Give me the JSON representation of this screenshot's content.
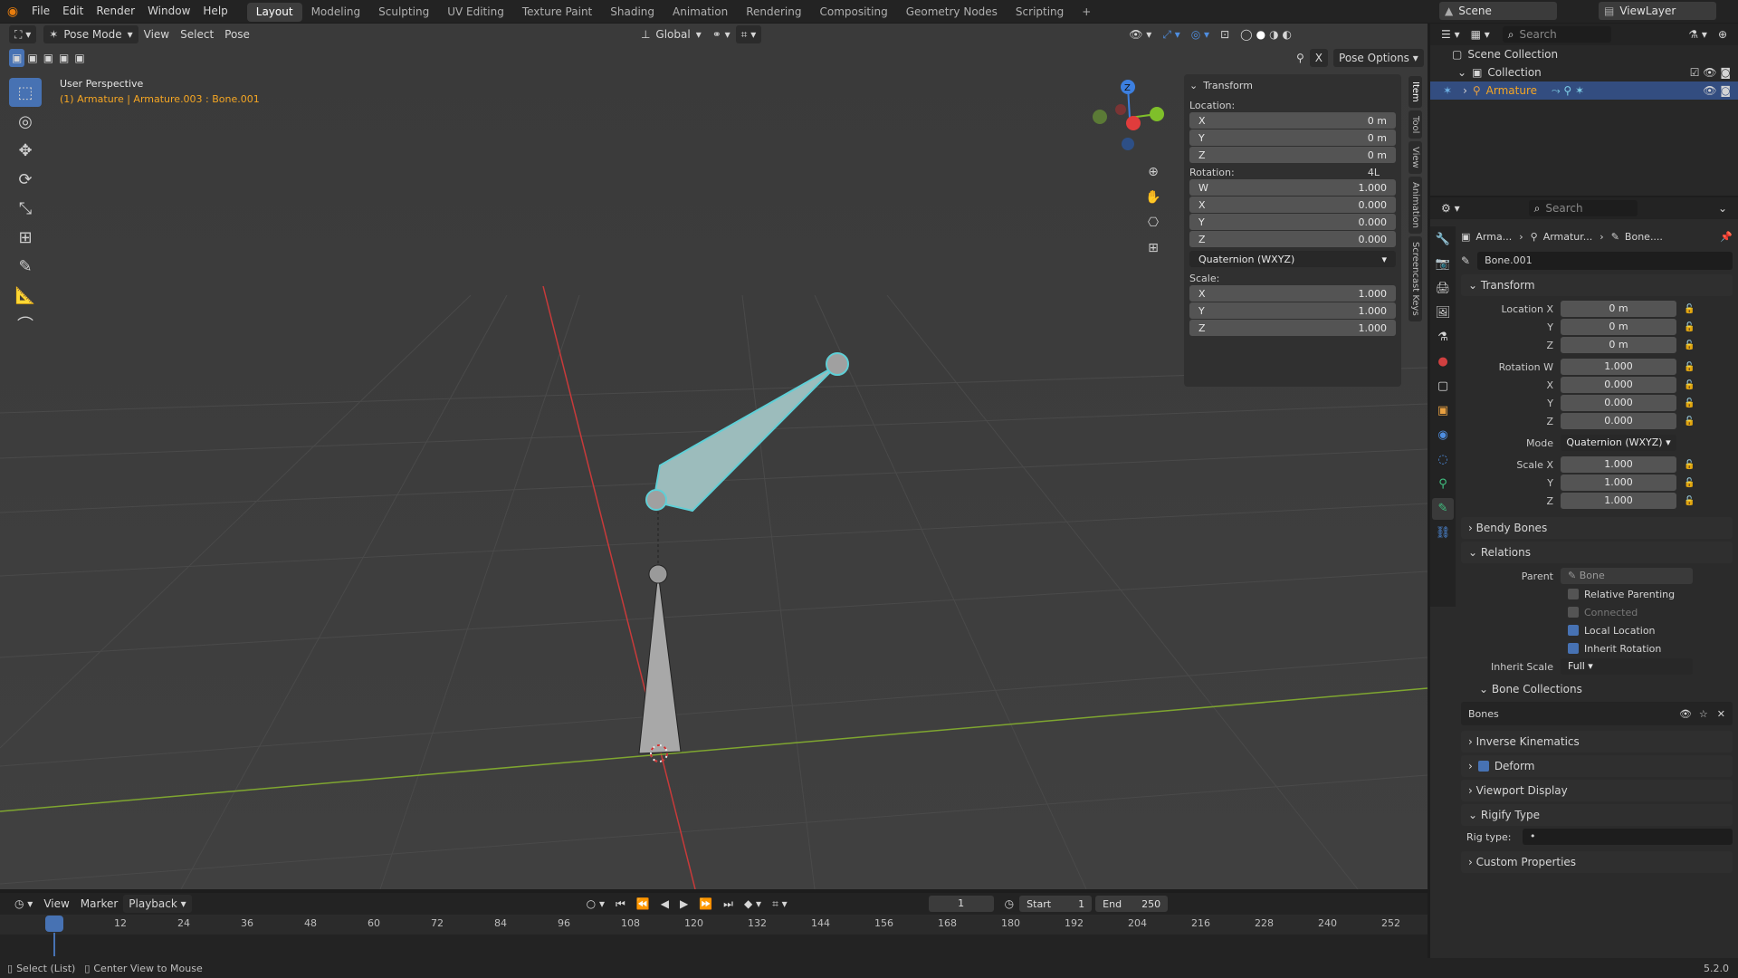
{
  "menus": [
    "File",
    "Edit",
    "Render",
    "Window",
    "Help"
  ],
  "workspaces": [
    "Layout",
    "Modeling",
    "Sculpting",
    "UV Editing",
    "Texture Paint",
    "Shading",
    "Animation",
    "Rendering",
    "Compositing",
    "Geometry Nodes",
    "Scripting",
    "+"
  ],
  "scene": {
    "label": "Scene",
    "viewlayer": "ViewLayer"
  },
  "viewport": {
    "mode": "Pose Mode",
    "menus": [
      "View",
      "Select",
      "Pose"
    ],
    "orientation": "Global",
    "pose_options": "Pose Options",
    "perspective": "User Perspective",
    "context": "(1) Armature | Armature.003 : Bone.001",
    "gizmo": {
      "z": "Z",
      "y": "Y",
      "x": "X"
    }
  },
  "npanel": {
    "header": "Transform",
    "location_label": "Location:",
    "location": [
      {
        "axis": "X",
        "value": "0 m"
      },
      {
        "axis": "Y",
        "value": "0 m"
      },
      {
        "axis": "Z",
        "value": "0 m"
      }
    ],
    "rotation_label": "Rotation:",
    "rotation_flag": "4L",
    "rotation": [
      {
        "axis": "W",
        "value": "1.000"
      },
      {
        "axis": "X",
        "value": "0.000"
      },
      {
        "axis": "Y",
        "value": "0.000"
      },
      {
        "axis": "Z",
        "value": "0.000"
      }
    ],
    "rotation_mode": "Quaternion (WXYZ)",
    "scale_label": "Scale:",
    "scale": [
      {
        "axis": "X",
        "value": "1.000"
      },
      {
        "axis": "Y",
        "value": "1.000"
      },
      {
        "axis": "Z",
        "value": "1.000"
      }
    ],
    "tabs": [
      "Item",
      "Tool",
      "View",
      "Animation",
      "Screencast Keys"
    ]
  },
  "outliner": {
    "search": "Search",
    "root": "Scene Collection",
    "collection": "Collection",
    "object": "Armature"
  },
  "properties": {
    "search": "Search",
    "breadcrumb": [
      "Arma...",
      "Armatur...",
      "Bone...."
    ],
    "bone_name": "Bone.001",
    "transform_header": "Transform",
    "location": [
      {
        "label": "Location X",
        "value": "0 m"
      },
      {
        "label": "Y",
        "value": "0 m"
      },
      {
        "label": "Z",
        "value": "0 m"
      }
    ],
    "rotation": [
      {
        "label": "Rotation W",
        "value": "1.000"
      },
      {
        "label": "X",
        "value": "0.000"
      },
      {
        "label": "Y",
        "value": "0.000"
      },
      {
        "label": "Z",
        "value": "0.000"
      }
    ],
    "mode_label": "Mode",
    "mode_value": "Quaternion (WXYZ)",
    "scale": [
      {
        "label": "Scale X",
        "value": "1.000"
      },
      {
        "label": "Y",
        "value": "1.000"
      },
      {
        "label": "Z",
        "value": "1.000"
      }
    ],
    "bendy_bones": "Bendy Bones",
    "relations": "Relations",
    "parent_label": "Parent",
    "parent_value": "Bone",
    "relative_parenting": "Relative Parenting",
    "connected": "Connected",
    "local_location": "Local Location",
    "inherit_rotation": "Inherit Rotation",
    "inherit_scale_label": "Inherit Scale",
    "inherit_scale_value": "Full",
    "bone_collections": "Bone Collections",
    "bones_item": "Bones",
    "inverse_kinematics": "Inverse Kinematics",
    "deform": "Deform",
    "viewport_display": "Viewport Display",
    "rigify_type": "Rigify Type",
    "rig_type_label": "Rig type:",
    "rig_type_value": "•",
    "custom_properties": "Custom Properties"
  },
  "timeline": {
    "menus": [
      "View",
      "Marker",
      "Playback"
    ],
    "current_frame": "1",
    "start_label": "Start",
    "start": "1",
    "end_label": "End",
    "end": "250",
    "ticks": [
      "1",
      "12",
      "24",
      "36",
      "48",
      "60",
      "72",
      "84",
      "96",
      "108",
      "120",
      "132",
      "144",
      "156",
      "168",
      "180",
      "192",
      "204",
      "216",
      "228",
      "240",
      "252"
    ]
  },
  "status": {
    "left": "Select (List)",
    "center": "Center View to Mouse",
    "version": "5.2.0"
  },
  "colors": {
    "accent": "#4772b3",
    "selected_bone": "#5fcfd6",
    "x_axis": "#e03c3c",
    "y_axis": "#7fbf2a",
    "z_axis": "#3c7fe0",
    "header_text": "#f5a623"
  }
}
